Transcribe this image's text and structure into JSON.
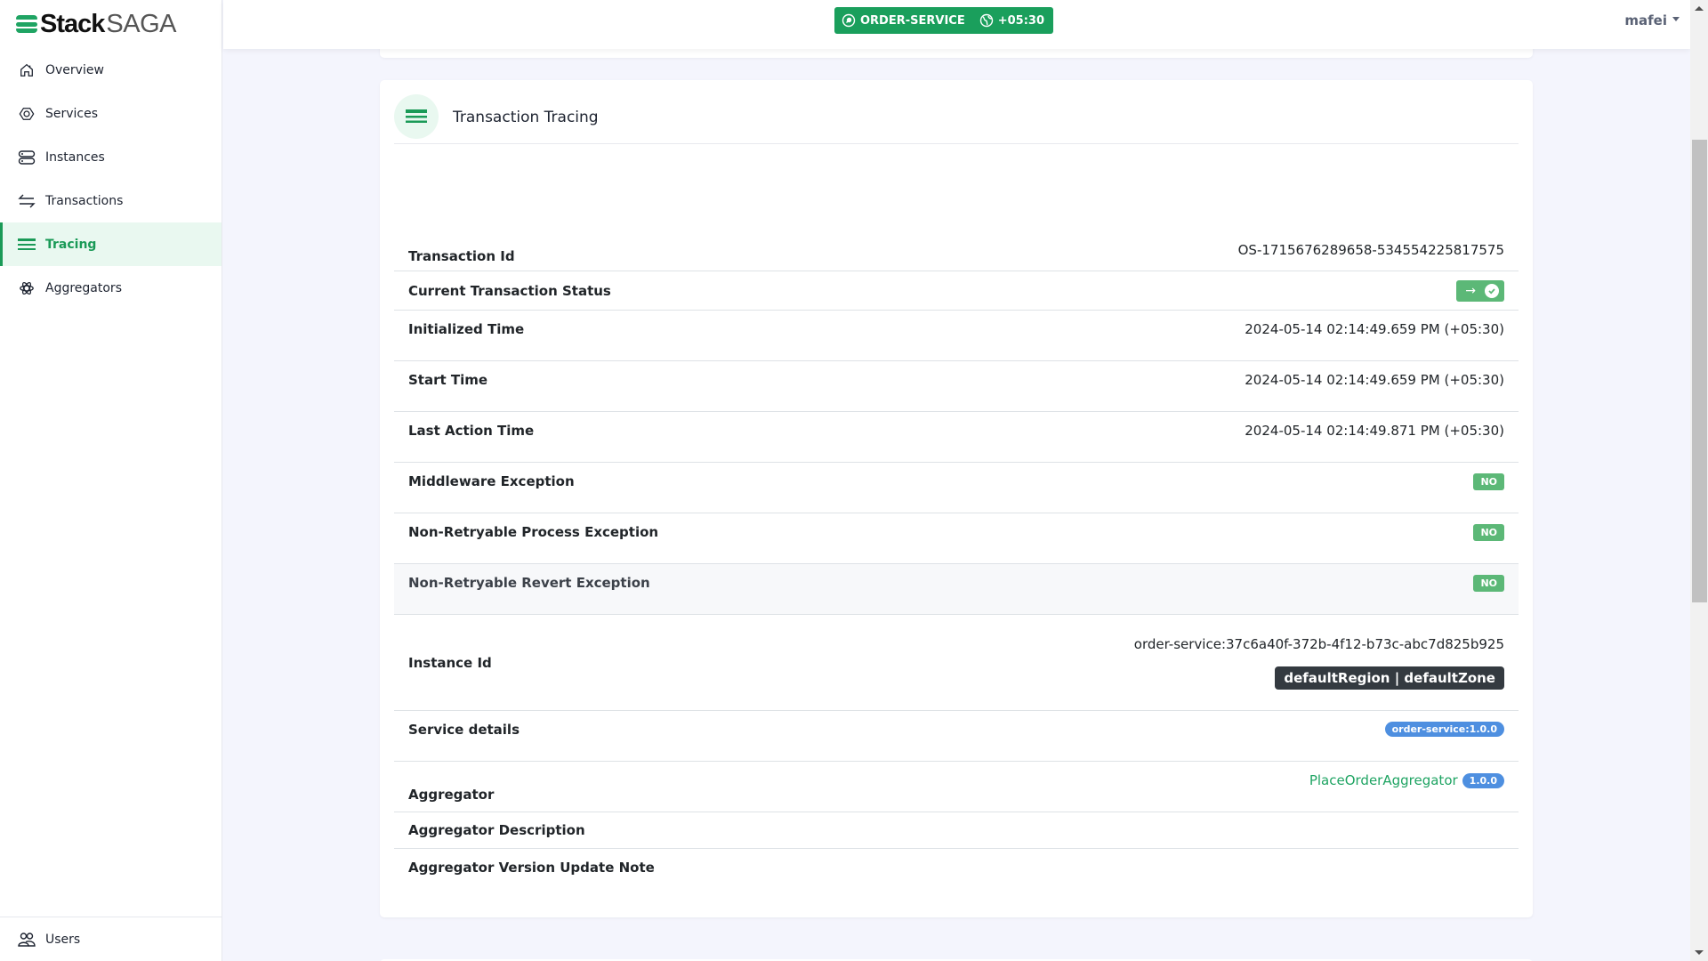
{
  "brand": {
    "name_bold": "Stack",
    "name_light": "SAGA"
  },
  "sidebar": {
    "items": [
      {
        "label": "Overview",
        "icon": "home-icon",
        "active": false
      },
      {
        "label": "Services",
        "icon": "hexagon-icon",
        "active": false
      },
      {
        "label": "Instances",
        "icon": "server-icon",
        "active": false
      },
      {
        "label": "Transactions",
        "icon": "arrows-exchange-icon",
        "active": false
      },
      {
        "label": "Tracing",
        "icon": "tracing-lines-icon",
        "active": true
      },
      {
        "label": "Aggregators",
        "icon": "atom-icon",
        "active": false
      }
    ],
    "bottom_item": {
      "label": "Users",
      "icon": "users-icon"
    }
  },
  "topbar": {
    "service_name": "ORDER-SERVICE",
    "timezone": "+05:30",
    "user": "mafei"
  },
  "card": {
    "title": "Transaction Tracing",
    "rows": {
      "transaction_id": {
        "label": "Transaction Id",
        "value": "OS-1715676289658-534554225817575"
      },
      "status": {
        "label": "Current Transaction Status",
        "arrow": "→",
        "state": "completed"
      },
      "initialized_time": {
        "label": "Initialized Time",
        "value": "2024-05-14 02:14:49.659 PM (+05:30)"
      },
      "start_time": {
        "label": "Start Time",
        "value": "2024-05-14 02:14:49.659 PM (+05:30)"
      },
      "last_action_time": {
        "label": "Last Action Time",
        "value": "2024-05-14 02:14:49.871 PM (+05:30)"
      },
      "middleware_exception": {
        "label": "Middleware Exception",
        "value": "NO"
      },
      "non_retryable_process_exception": {
        "label": "Non-Retryable Process Exception",
        "value": "NO"
      },
      "non_retryable_revert_exception": {
        "label": "Non-Retryable Revert Exception",
        "value": "NO"
      },
      "instance_id": {
        "label": "Instance Id",
        "value": "order-service:37c6a40f-372b-4f12-b73c-abc7d825b925",
        "region_zone": "defaultRegion | defaultZone"
      },
      "service_details": {
        "label": "Service details",
        "value": "order-service:1.0.0"
      },
      "aggregator": {
        "label": "Aggregator",
        "name": "PlaceOrderAggregator",
        "version": "1.0.0"
      },
      "aggregator_description": {
        "label": "Aggregator Description",
        "value": ""
      },
      "aggregator_version_note": {
        "label": "Aggregator Version Update Note",
        "value": ""
      }
    }
  },
  "colors": {
    "brand_green": "#1a9f5c",
    "badge_green": "#5cb877",
    "badge_blue": "#4e8fe0",
    "badge_dark": "#343a40"
  }
}
